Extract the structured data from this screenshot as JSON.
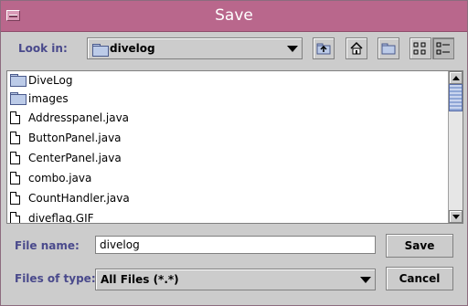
{
  "window": {
    "title": "Save"
  },
  "lookin": {
    "label": "Look in:",
    "current_folder": "divelog"
  },
  "toolbar": {
    "up_icon": "up-folder-icon",
    "home_icon": "home-icon",
    "new_folder_icon": "new-folder-icon",
    "list_view_icon": "list-view-icon",
    "details_view_icon": "details-view-icon"
  },
  "files": [
    {
      "name": "DiveLog",
      "kind": "folder"
    },
    {
      "name": "images",
      "kind": "folder"
    },
    {
      "name": "Addresspanel.java",
      "kind": "file"
    },
    {
      "name": "ButtonPanel.java",
      "kind": "file"
    },
    {
      "name": "CenterPanel.java",
      "kind": "file"
    },
    {
      "name": "combo.java",
      "kind": "file"
    },
    {
      "name": "CountHandler.java",
      "kind": "file"
    },
    {
      "name": "diveflag.GIF",
      "kind": "file"
    }
  ],
  "filename": {
    "label": "File name:",
    "value": "divelog"
  },
  "filetype": {
    "label": "Files of type:",
    "value": "All Files (*.*)"
  },
  "buttons": {
    "save": "Save",
    "cancel": "Cancel"
  },
  "colors": {
    "titlebar": "#b9678c",
    "label": "#4a4a8c",
    "background": "#cccccc"
  }
}
